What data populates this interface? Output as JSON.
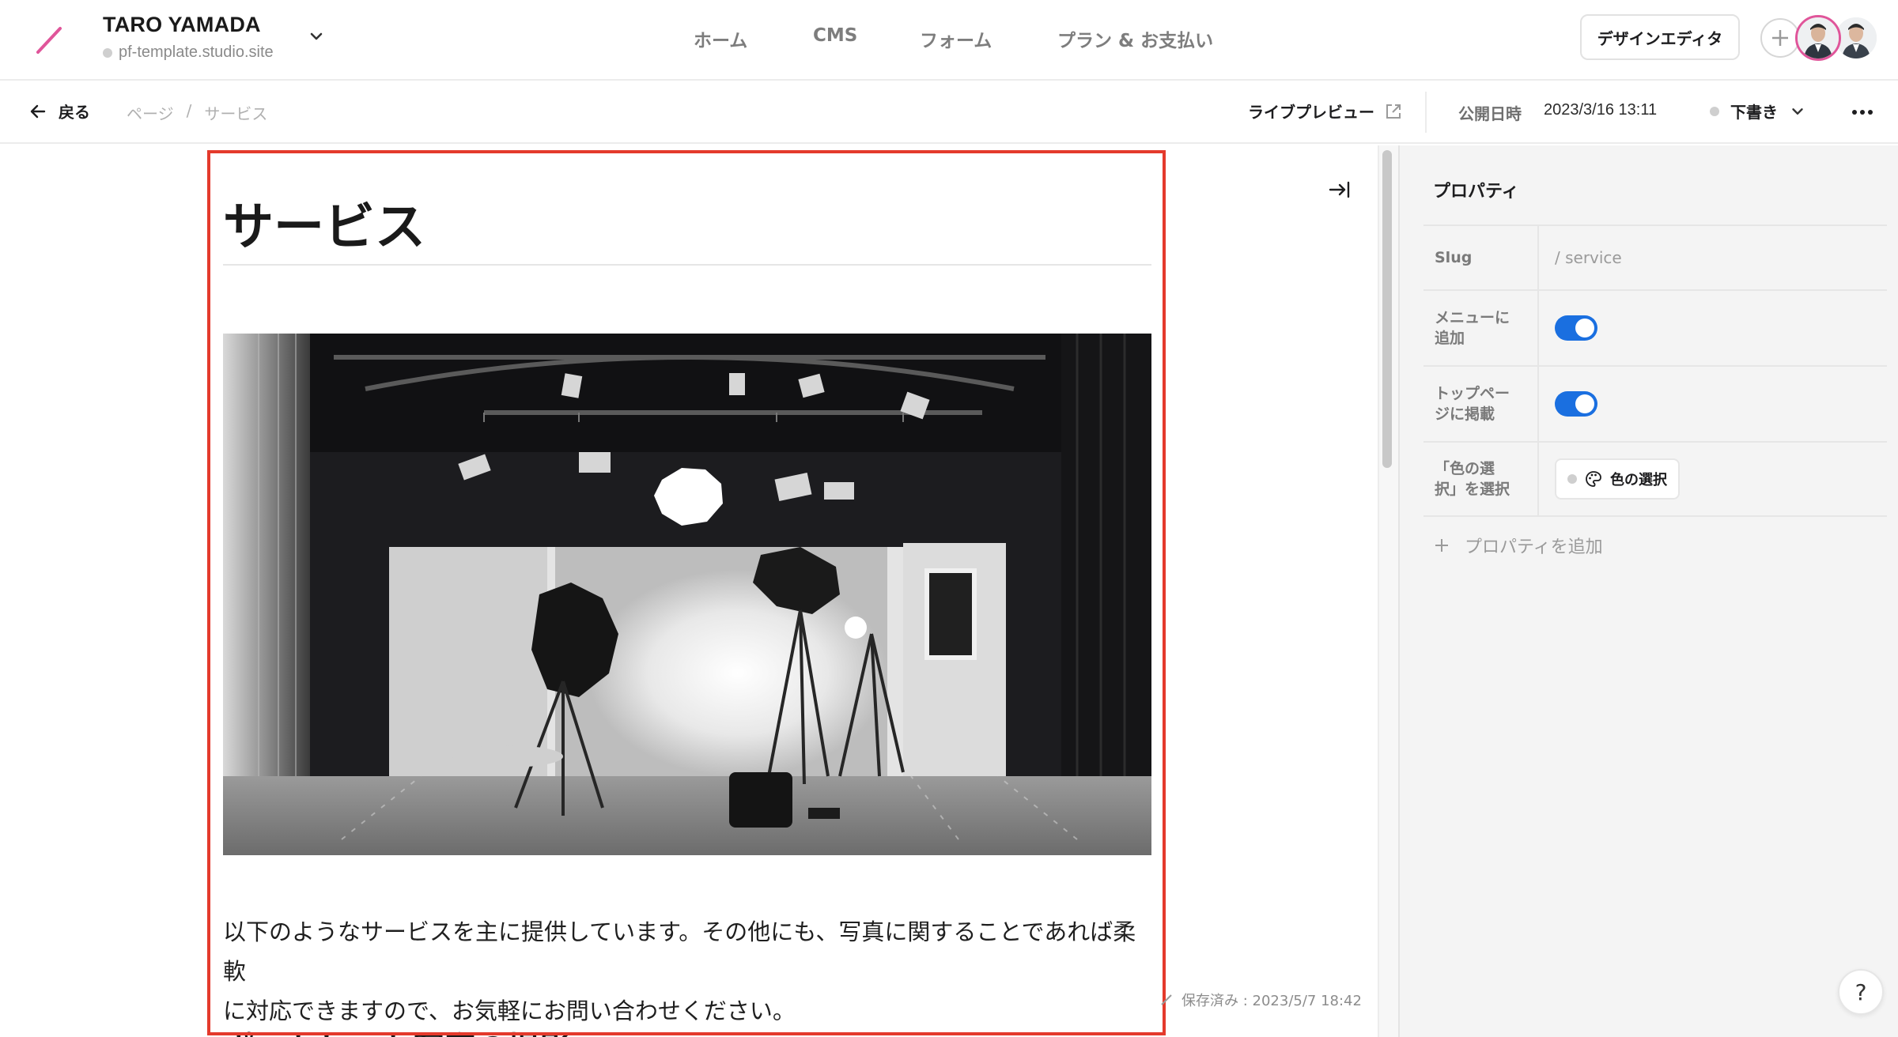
{
  "header": {
    "site_name": "TARO YAMADA",
    "site_url": "pf-template.studio.site",
    "nav": [
      "ホーム",
      "CMS",
      "フォーム",
      "プラン & お支払い"
    ],
    "design_editor_label": "デザインエディタ",
    "brand_color": "#e0559a"
  },
  "subbar": {
    "back_label": "戻る",
    "breadcrumb": [
      "ページ",
      "/",
      "サービス"
    ],
    "live_preview_label": "ライブプレビュー",
    "publish_label": "公開日時",
    "publish_value": "2023/3/16 13:11",
    "status_label": "下書き"
  },
  "editor": {
    "title": "サービス",
    "body_line1": "以下のようなサービスを主に提供しています。その他にも、写真に関することであれば柔軟",
    "body_line2": "に対応できますので、お気軽にお問い合わせください。",
    "subheading": "ポートレート写真の撮影",
    "saved_text": "保存済み : 2023/5/7 18:42",
    "selection_color": "#e43a2c"
  },
  "panel": {
    "title": "プロパティ",
    "properties": [
      {
        "key": "Slug",
        "value": "/ service"
      },
      {
        "key_line1": "メニューに",
        "key_line2": "追加",
        "toggle": true
      },
      {
        "key_line1": "トップペー",
        "key_line2": "ジに掲載",
        "toggle": true
      },
      {
        "key_line1": "「色の選",
        "key_line2": "択」を選択",
        "button_label": "色の選択"
      }
    ],
    "add_property_label": "プロパティを追加",
    "toggle_color": "#1a6fe0"
  },
  "help_label": "?"
}
